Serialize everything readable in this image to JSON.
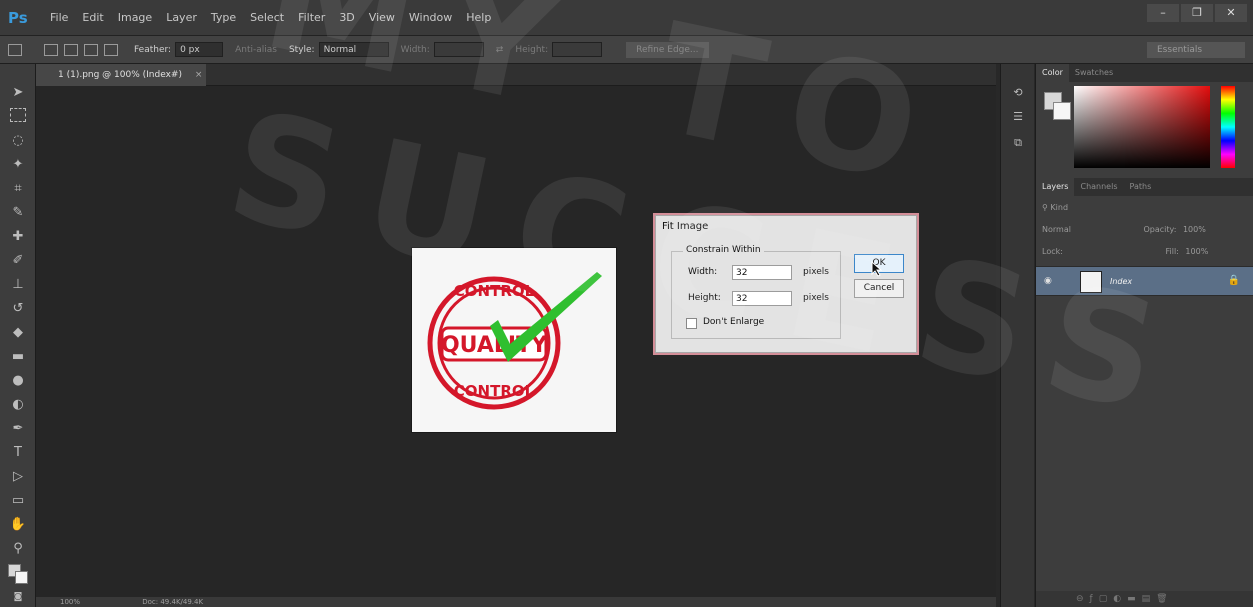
{
  "app": {
    "logo": "Ps"
  },
  "menu": [
    "File",
    "Edit",
    "Image",
    "Layer",
    "Type",
    "Select",
    "Filter",
    "3D",
    "View",
    "Window",
    "Help"
  ],
  "window_controls": {
    "minimize": "–",
    "restore": "❐",
    "close": "✕"
  },
  "options_bar": {
    "feather_label": "Feather:",
    "feather_value": "0 px",
    "antialias_label": "Anti-alias",
    "style_label": "Style:",
    "style_value": "Normal",
    "width_label": "Width:",
    "height_label": "Height:",
    "refine_edge": "Refine Edge...",
    "workspace": "Essentials"
  },
  "document": {
    "tab_title": "1 (1).png @ 100% (Index#)",
    "tab_close": "×"
  },
  "status_bar": {
    "zoom": "100%",
    "doc_info": "Doc: 49.4K/49.4K"
  },
  "dialog": {
    "title": "Fit Image",
    "group_label": "Constrain Within",
    "width_label": "Width:",
    "width_value": "32",
    "width_unit": "pixels",
    "height_label": "Height:",
    "height_value": "32",
    "height_unit": "pixels",
    "dont_enlarge_label": "Don't Enlarge",
    "dont_enlarge_checked": false,
    "ok_label": "OK",
    "cancel_label": "Cancel"
  },
  "image_content": {
    "top_text": "CONTROL",
    "middle_text": "QUALITY",
    "bottom_text": "CONTROL",
    "stamp_color": "#d4172a",
    "check_color": "#2fbf2f"
  },
  "color_panel": {
    "tabs": [
      "Color",
      "Swatches"
    ],
    "foreground": "#d8d8d8",
    "background": "#f6f6f6"
  },
  "layers_panel": {
    "tabs": [
      "Layers",
      "Channels",
      "Paths"
    ],
    "kind_label": "Kind",
    "blend_mode": "Normal",
    "opacity_label": "Opacity:",
    "opacity_value": "100%",
    "lock_label": "Lock:",
    "fill_label": "Fill:",
    "fill_value": "100%",
    "layer_name": "Index"
  },
  "watermark": {
    "text": "MY TO SUCCESS"
  }
}
